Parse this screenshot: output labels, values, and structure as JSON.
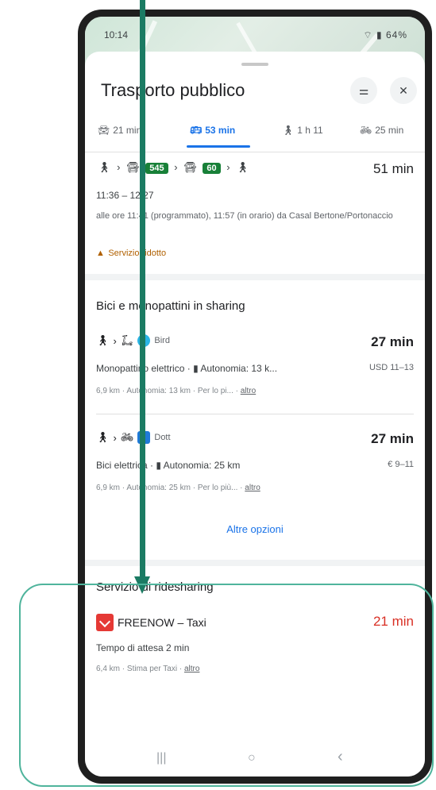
{
  "status": {
    "time": "10:14",
    "battery": "64%"
  },
  "header": {
    "title": "Trasporto pubblico",
    "filter_icon": "tune-icon",
    "close_label": "✕"
  },
  "tabs": [
    {
      "label": "21 min",
      "icon": "car-icon"
    },
    {
      "label": "53 min",
      "icon": "bus-icon",
      "active": true
    },
    {
      "label": "1 h 11",
      "icon": "walk-icon"
    },
    {
      "label": "25 min",
      "icon": "bike-icon"
    }
  ],
  "transit": {
    "chip1": "545",
    "chip2": "60",
    "duration": "51 min",
    "time_range": "11:36 – 12:27",
    "departure_info": "alle ore 11:41 (programmato), 11:57 (in orario) da Casal Bertone/Portonaccio",
    "warning": "Servizio ridotto"
  },
  "sharing": {
    "title": "Bici e monopattini in sharing",
    "options": [
      {
        "brand": "Bird",
        "duration": "27 min",
        "vehicle": "Monopattino elettrico · ",
        "range": "Autonomia: 13 k...",
        "price": "USD 11–13",
        "details": "6,9 km · Autonomia: 13 km · Per lo pi... · ",
        "more": "altro"
      },
      {
        "brand": "Dott",
        "duration": "27 min",
        "vehicle": "Bici elettrica · ",
        "range": "Autonomia: 25 km",
        "price": "€ 9–11",
        "details": "6,9 km · Autonomia: 25 km · Per lo più... · ",
        "more": "altro"
      }
    ],
    "more_options": "Altre opzioni"
  },
  "ridesharing": {
    "title": "Servizio di ridesharing",
    "provider": "FREENOW – Taxi",
    "duration": "21 min",
    "wait": "Tempo di attesa 2 min",
    "details": "6,4 km · Stima per Taxi · ",
    "more": "altro"
  },
  "navbar": {
    "recent": "|||",
    "home": "○",
    "back": "‹"
  },
  "colors": {
    "accent": "#1a73e8",
    "annotation": "#1b7b63",
    "highlight": "#4fb49c",
    "taxi_red": "#e53935"
  }
}
